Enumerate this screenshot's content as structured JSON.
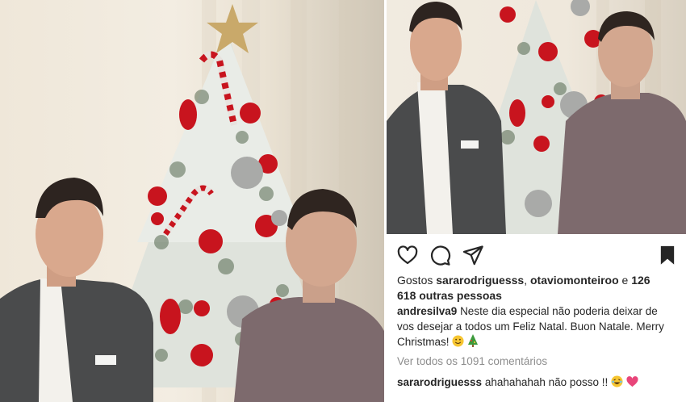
{
  "post": {
    "likes": {
      "prefix": "Gostos",
      "user1": "sararodriguesss",
      "separator": ",",
      "user2": "otaviomonteiroo",
      "connector": "e",
      "count": "126 618",
      "suffix": "outras pessoas"
    },
    "caption": {
      "username": "andresilva9",
      "text": "Neste dia especial não poderia deixar de vos desejar a todos um Feliz Natal. Buon Natale. Merry Christmas!"
    },
    "view_all_comments": "Ver todos os 1091 comentários",
    "comment": {
      "username": "sararodriguesss",
      "text": "ahahahahah não posso !!"
    }
  },
  "icons": {
    "like": "heart-outline-icon",
    "comment": "speech-bubble-icon",
    "share": "paper-plane-icon",
    "save": "bookmark-filled-icon",
    "caption_emoji": [
      "smiley-emoji",
      "christmas-tree-emoji"
    ],
    "comment_emoji": [
      "laughing-emoji",
      "pink-heart-emoji"
    ]
  },
  "colors": {
    "text": "#262626",
    "muted": "#8e8e8e",
    "ornament_red": "#c8141e",
    "heart_pink": "#e8457a"
  }
}
